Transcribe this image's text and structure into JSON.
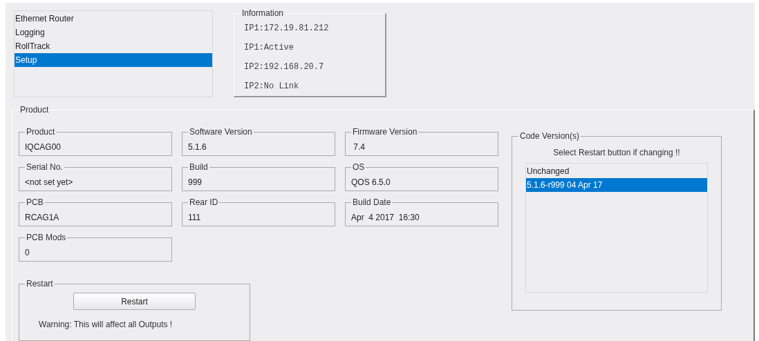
{
  "nav": {
    "items": [
      {
        "label": "Ethernet Router",
        "selected": false
      },
      {
        "label": "Logging",
        "selected": false
      },
      {
        "label": "RollTrack",
        "selected": false
      },
      {
        "label": "Setup",
        "selected": true
      }
    ]
  },
  "information": {
    "title": "Information",
    "lines": [
      "IP1:172.19.81.212",
      "IP1:Active",
      "IP2:192.168.20.7",
      "IP2:No Link"
    ]
  },
  "product": {
    "title": "Product",
    "fields": [
      {
        "label": "Product",
        "value": "IQCAG00"
      },
      {
        "label": "Software Version",
        "value": "5.1.6"
      },
      {
        "label": "Firmware Version",
        "value": " 7.4"
      },
      {
        "label": "Serial No.",
        "value": "<not set yet>"
      },
      {
        "label": "Build",
        "value": "999"
      },
      {
        "label": "OS",
        "value": "QOS 6.5.0"
      },
      {
        "label": "PCB",
        "value": "RCAG1A"
      },
      {
        "label": "Rear ID",
        "value": "111"
      },
      {
        "label": "Build Date",
        "value": "Apr  4 2017  16:30"
      },
      {
        "label": "PCB Mods",
        "value": "0"
      }
    ],
    "restart": {
      "title": "Restart",
      "button": "Restart",
      "warning": "Warning: This will affect all Outputs !"
    },
    "code_versions": {
      "title": "Code Version(s)",
      "hint": "Select Restart button if changing !!",
      "items": [
        {
          "label": "Unchanged",
          "selected": false
        },
        {
          "label": "5.1.6-r999 04 Apr 17",
          "selected": true
        }
      ]
    }
  }
}
